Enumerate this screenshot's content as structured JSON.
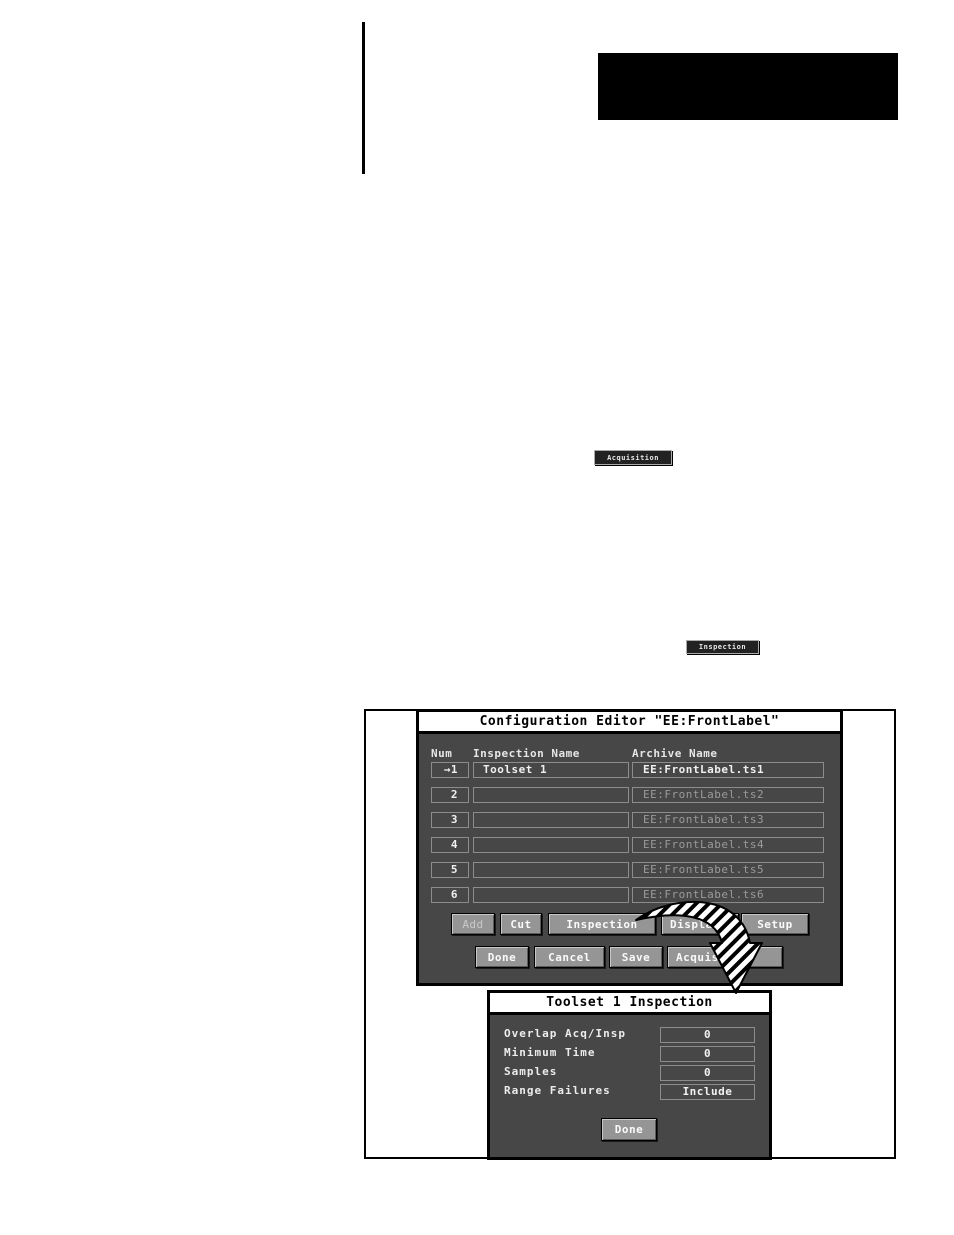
{
  "page": {
    "inline_buttons": {
      "acquisition": "Acquisition",
      "inspection": "Inspection"
    }
  },
  "config_editor": {
    "title": "Configuration Editor \"EE:FrontLabel\"",
    "columns": {
      "num": "Num",
      "inspection_name": "Inspection Name",
      "archive_name": "Archive Name"
    },
    "rows": [
      {
        "num": "→1",
        "name": "Toolset 1",
        "archive": "EE:FrontLabel.ts1",
        "active": true
      },
      {
        "num": "2",
        "name": "",
        "archive": "EE:FrontLabel.ts2",
        "active": false
      },
      {
        "num": "3",
        "name": "",
        "archive": "EE:FrontLabel.ts3",
        "active": false
      },
      {
        "num": "4",
        "name": "",
        "archive": "EE:FrontLabel.ts4",
        "active": false
      },
      {
        "num": "5",
        "name": "",
        "archive": "EE:FrontLabel.ts5",
        "active": false
      },
      {
        "num": "6",
        "name": "",
        "archive": "EE:FrontLabel.ts6",
        "active": false
      }
    ],
    "buttons_row1": {
      "add": "Add",
      "cut": "Cut",
      "inspection": "Inspection",
      "display": "Display",
      "setup": "Setup"
    },
    "buttons_row2": {
      "done": "Done",
      "cancel": "Cancel",
      "save": "Save",
      "acquisition": "Acquisition"
    }
  },
  "inspection_dialog": {
    "title": "Toolset 1 Inspection",
    "fields": [
      {
        "label": "Overlap Acq/Insp",
        "value": "0"
      },
      {
        "label": "Minimum Time",
        "value": "0"
      },
      {
        "label": "Samples",
        "value": "0"
      },
      {
        "label": "Range Failures",
        "value": "Include"
      }
    ],
    "done": "Done"
  },
  "colors": {
    "window_bg": "#474747",
    "button_bg": "#959595",
    "title_bg": "#ffffff"
  }
}
